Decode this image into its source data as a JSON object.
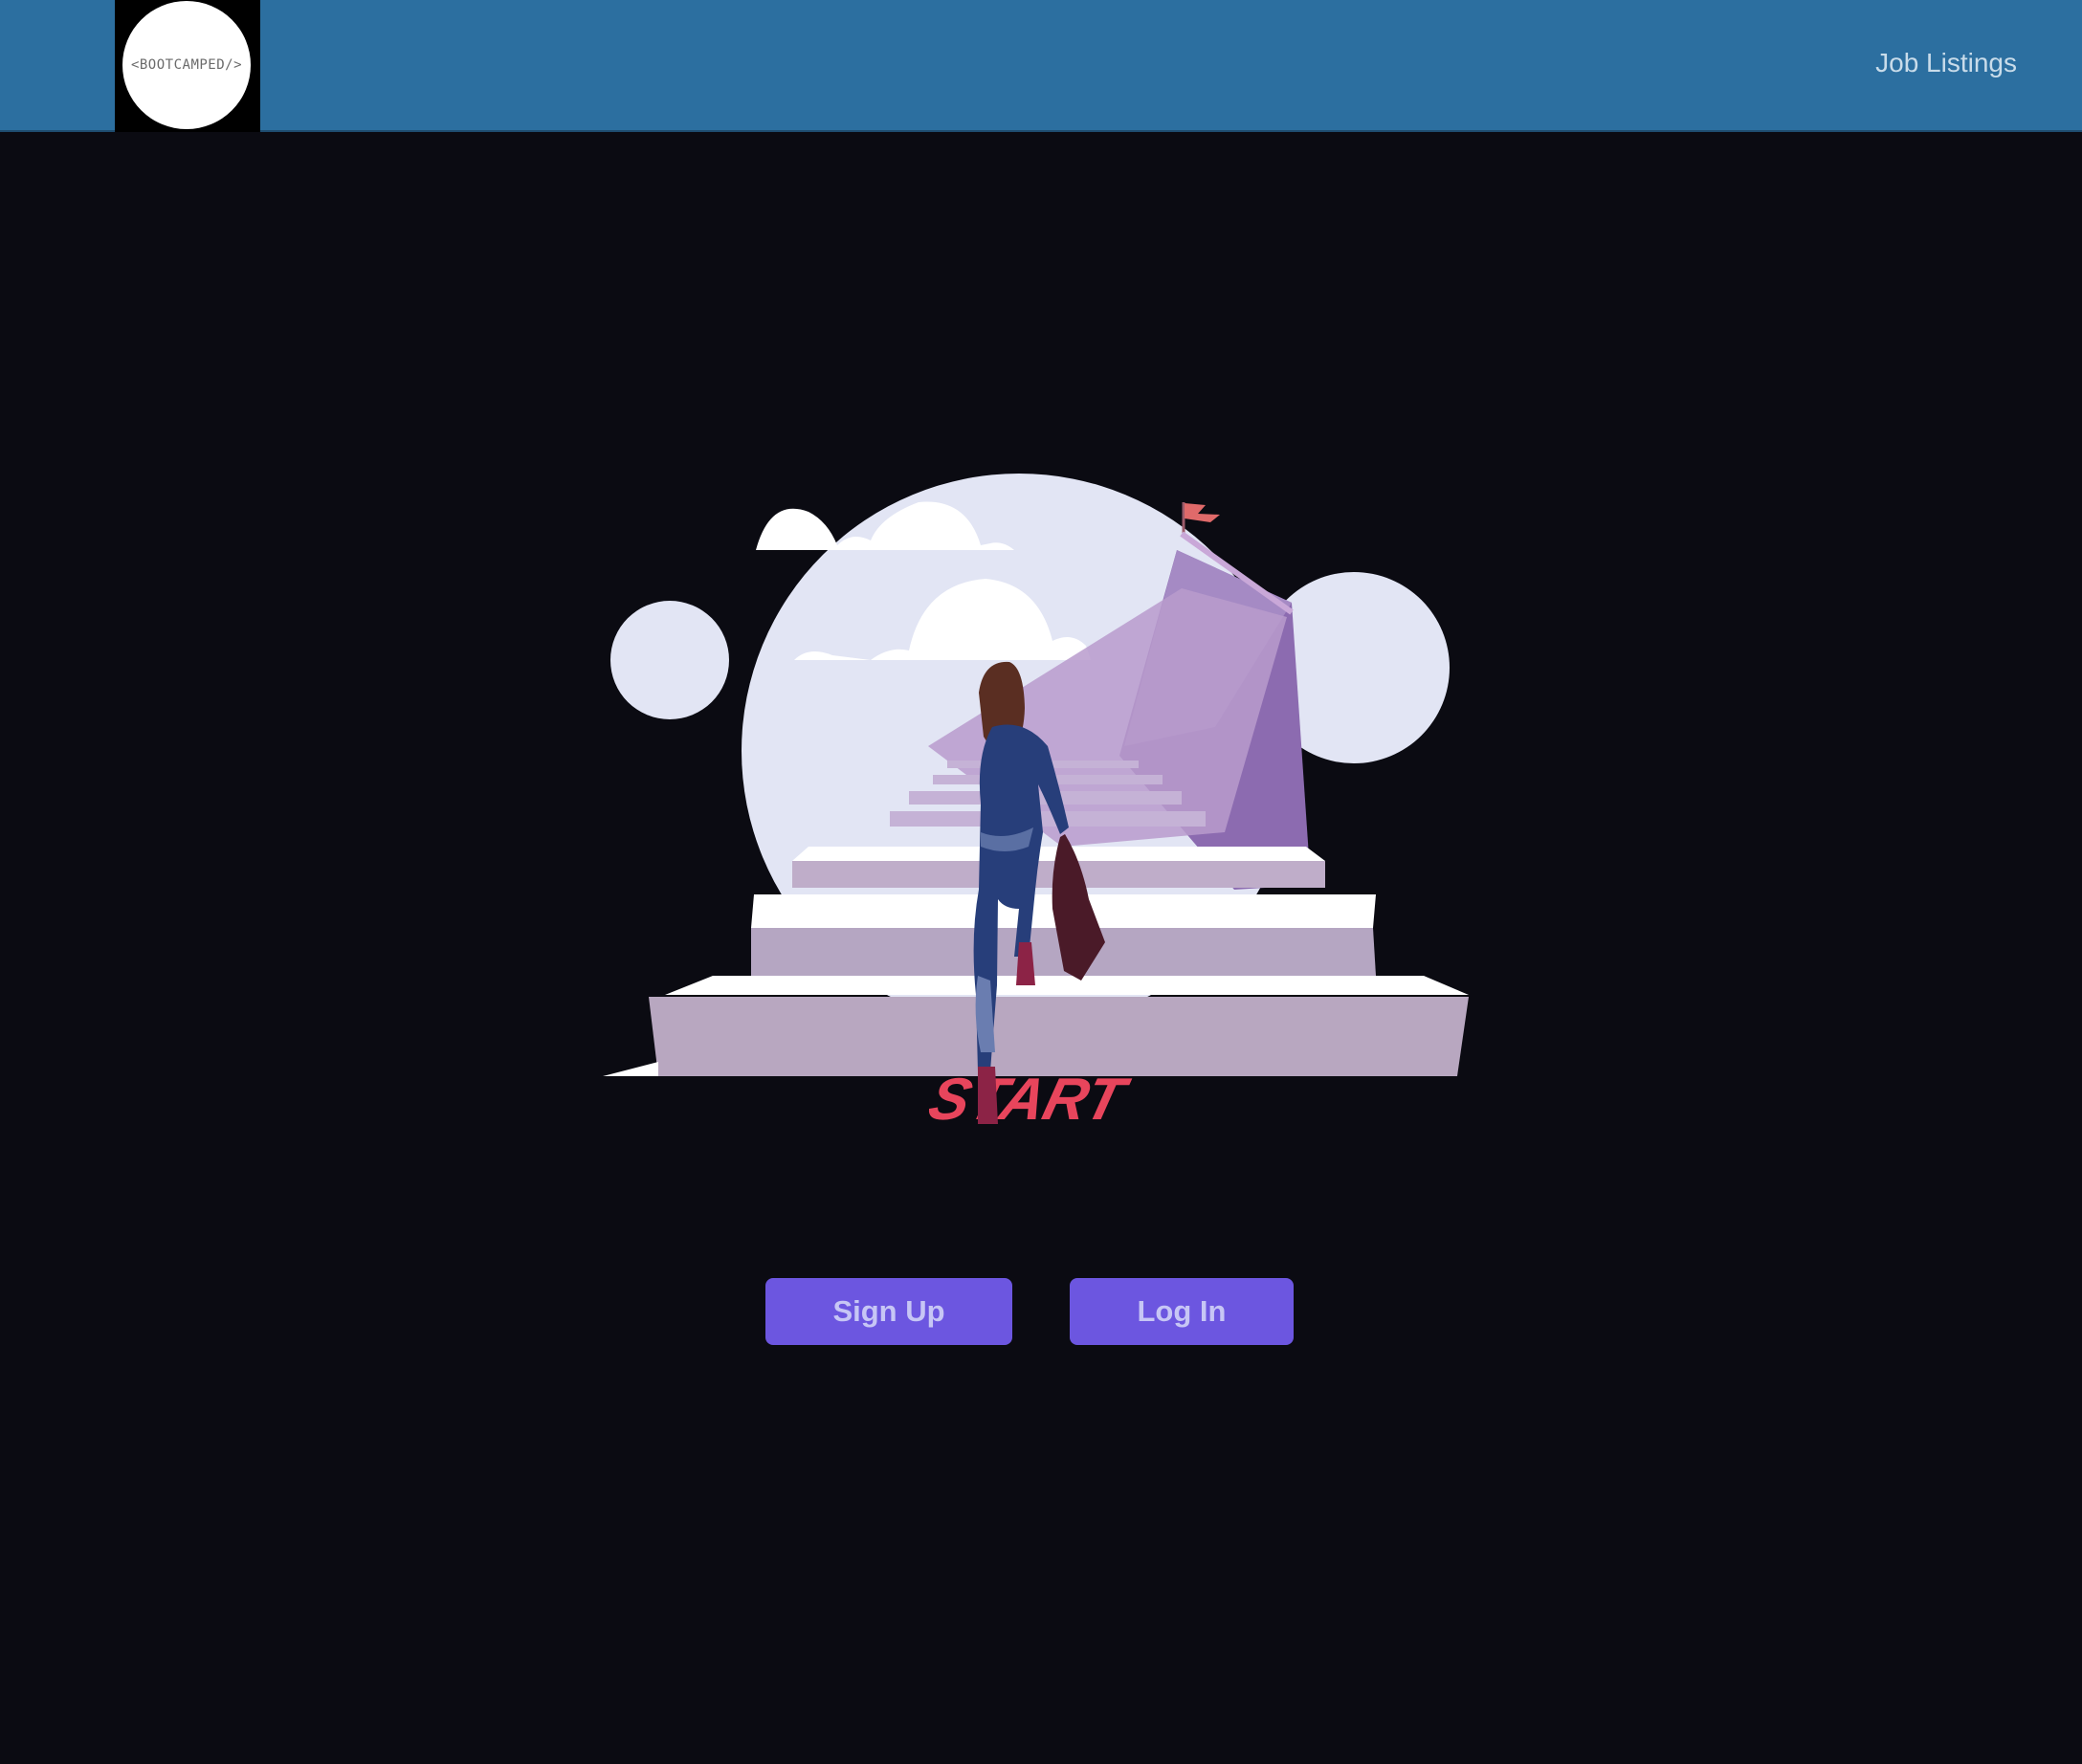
{
  "nav": {
    "logo_text": "<BOOTCAMPED/>",
    "links": [
      "Job Listings"
    ]
  },
  "hero": {
    "image": "woman-climbing-stairs-illustration",
    "start_text": "START"
  },
  "actions": {
    "signup_label": "Sign Up",
    "login_label": "Log In"
  },
  "colors": {
    "navbar": "#2c6fa0",
    "background": "#0b0b12",
    "button": "#6c56e0",
    "button_text": "#c7c6f5",
    "start_text": "#e8455c"
  }
}
